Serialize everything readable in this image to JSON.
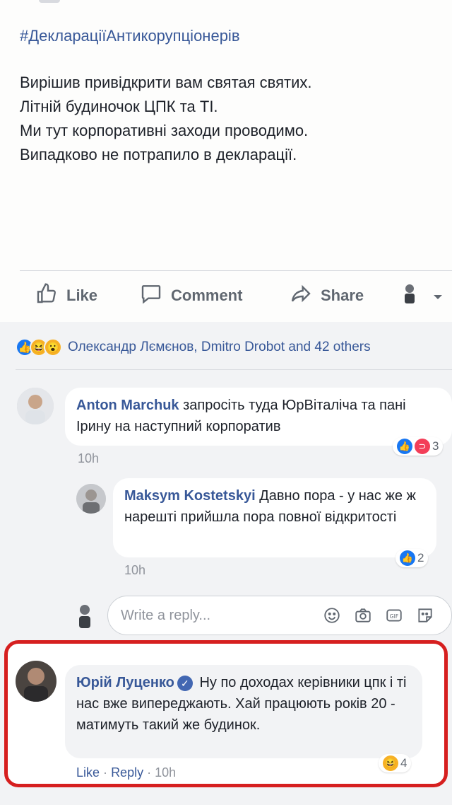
{
  "post": {
    "hashtag": "#ДекларaціїАнтикорупціонерів",
    "lines": [
      "Вирішив привідкрити вам святая святих.",
      "Літній будиночок ЦПК та ТІ.",
      "Ми тут корпоративні заходи проводимо.",
      "Випадково не потрапило в декларації."
    ]
  },
  "actions": {
    "like_label": "Like",
    "comment_label": "Comment",
    "share_label": "Share"
  },
  "reactions": {
    "summary": "Олександр Лємєнов, Dmitro Drobot and 42 others"
  },
  "comments": [
    {
      "author": "Anton Marchuk",
      "text": "запросіть туда ЮрВіталіча та пані Ірину на наступний корпоратив",
      "time": "10h",
      "reaction_count": "3"
    },
    {
      "author": "Maksym Kostetskyi",
      "text": "Давно пора - у нас же ж нарешті прийшла пора повної відкритості",
      "time": "10h",
      "reaction_count": "2"
    }
  ],
  "reply_box": {
    "placeholder": "Write a reply..."
  },
  "highlighted_comment": {
    "author": "Юрій Луценко",
    "text": "Ну по доходах керівники цпк і ті нас вже випереджають. Хай працюють років 20 - матимуть такий же будинок.",
    "like_label": "Like",
    "reply_label": "Reply",
    "separator": "·",
    "time": "10h",
    "reaction_count": "4"
  },
  "colors": {
    "link": "#385898",
    "highlight_border": "#d61f1f",
    "like_blue": "#1877f2",
    "haha_yellow": "#f7b125"
  }
}
